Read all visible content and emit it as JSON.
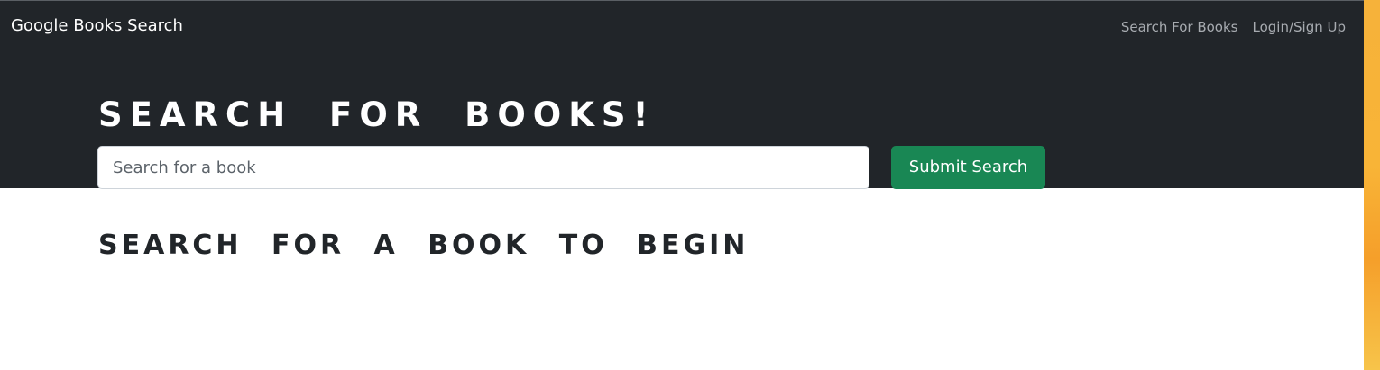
{
  "navbar": {
    "brand": "Google Books Search",
    "links": [
      {
        "label": "Search For Books"
      },
      {
        "label": "Login/Sign Up"
      }
    ]
  },
  "jumbotron": {
    "title": "SEARCH FOR BOOKS!",
    "search": {
      "placeholder": "Search for a book",
      "value": ""
    },
    "submit_label": "Submit Search"
  },
  "main": {
    "heading": "SEARCH FOR A BOOK TO BEGIN"
  },
  "colors": {
    "dark_background": "#212529",
    "submit_button": "#198754",
    "heading_text": "#212529"
  }
}
